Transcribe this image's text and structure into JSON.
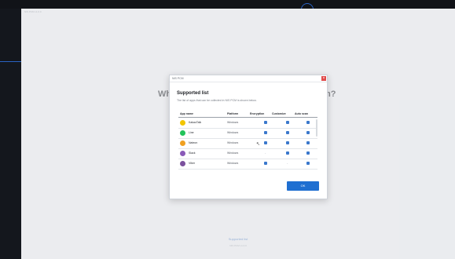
{
  "window": {
    "title": "NIS PCM v1.0.0"
  },
  "background": {
    "heading_left": "Wh",
    "heading_right": "m?",
    "supported_link": "Supported list",
    "caption": "NIS PCM v1.0.0"
  },
  "dialog": {
    "titlebar": "NIS PCM",
    "close_glyph": "×",
    "heading": "Supported list",
    "description": "The list of apps that can be collected in NIS PCM is shown below.",
    "columns": {
      "app_name": "App name",
      "platform": "Platform",
      "encryption": "Encryption",
      "customize": "Customize",
      "auto_scan": "Auto scan"
    },
    "rows": [
      {
        "name": "KakaoTalk",
        "platform": "Windows",
        "icon_color": "#f2c500",
        "encryption": true,
        "customize": true,
        "auto_scan": true
      },
      {
        "name": "Line",
        "platform": "Windows",
        "icon_color": "#22c35a",
        "encryption": true,
        "customize": true,
        "auto_scan": true
      },
      {
        "name": "Nateon",
        "platform": "Windows",
        "icon_color": "#f0a020",
        "encryption": true,
        "customize": true,
        "auto_scan": true
      },
      {
        "name": "Slack",
        "platform": "Windows",
        "icon_color": "#8a5ab8",
        "encryption": "-",
        "customize": true,
        "auto_scan": true
      },
      {
        "name": "Viber",
        "platform": "Windows",
        "icon_color": "#7b519d",
        "encryption": true,
        "customize": "-",
        "auto_scan": true
      }
    ],
    "ok_label": "OK"
  },
  "colors": {
    "accent": "#1f6fd1",
    "close": "#e04a4a",
    "check": "#3a78cc"
  }
}
